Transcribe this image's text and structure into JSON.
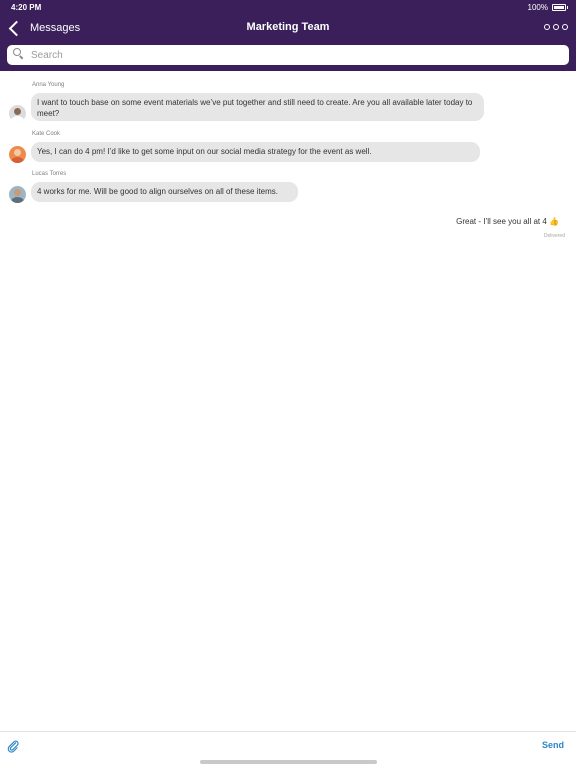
{
  "status_bar": {
    "time": "4:20 PM",
    "battery": "100%"
  },
  "nav": {
    "back_label": "Messages",
    "title": "Marketing Team",
    "more_icon": "more-dots-icon"
  },
  "search": {
    "placeholder": "Search"
  },
  "messages": [
    {
      "sender": "Anna Young",
      "avatar": "avatar-anna-young",
      "text": "I want to touch base on some event materials we’ve put together and still need to create. Are you all available later today to meet?"
    },
    {
      "sender": "Kate Cook",
      "avatar": "avatar-kate-cook",
      "text": "Yes, I can do 4 pm! I’d like to get some input on our social media strategy for the event as well."
    },
    {
      "sender": "Lucas Torres",
      "avatar": "avatar-lucas-torres",
      "text": "4 works for me. Will be good to align ourselves on all of these items."
    }
  ],
  "outgoing": {
    "text": "Great - I’ll see you all at 4 👍",
    "status": "Delivered"
  },
  "composer": {
    "attach_icon": "paperclip-icon",
    "send_label": "Send"
  },
  "colors": {
    "header_bg": "#3a1f5a",
    "incoming_bubble": "#e6e6e6",
    "send_blue": "#2c86c8"
  }
}
